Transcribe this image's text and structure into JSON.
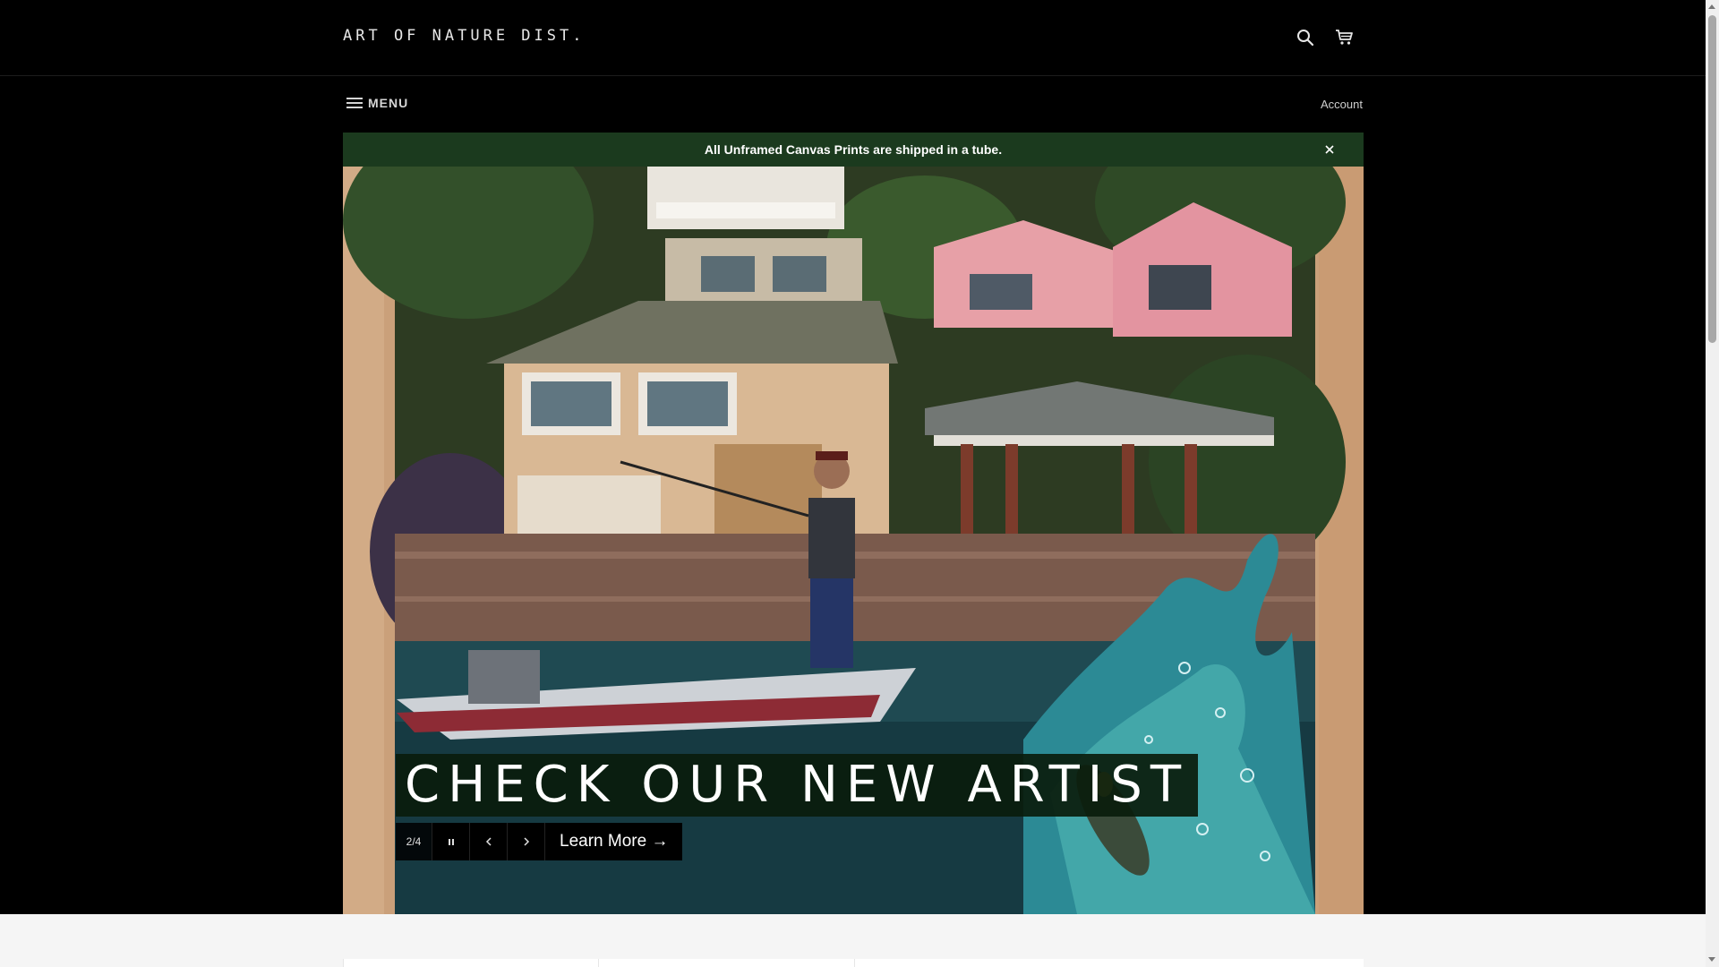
{
  "header": {
    "logo_text": "ART OF NATURE DIST.",
    "search_icon": "search-icon",
    "cart_icon": "cart-icon"
  },
  "nav": {
    "menu_label": "MENU",
    "menu_icon": "hamburger-icon",
    "account_label": "Account"
  },
  "announcement": {
    "text": "All Unframed Canvas Prints are shipped in a tube.",
    "close_icon": "close-icon",
    "background": "#1b3a1e"
  },
  "hero": {
    "heading": "CHECK OUR NEW ARTIST",
    "slide_counter": "2/4",
    "pause_icon": "pause-icon",
    "prev_icon": "chevron-left-icon",
    "next_icon": "chevron-right-icon",
    "cta_label": "Learn More →"
  },
  "colors": {
    "page_background": "#000000",
    "heading_box": "#0a1c0c",
    "lower_section": "#f5f5f5"
  }
}
